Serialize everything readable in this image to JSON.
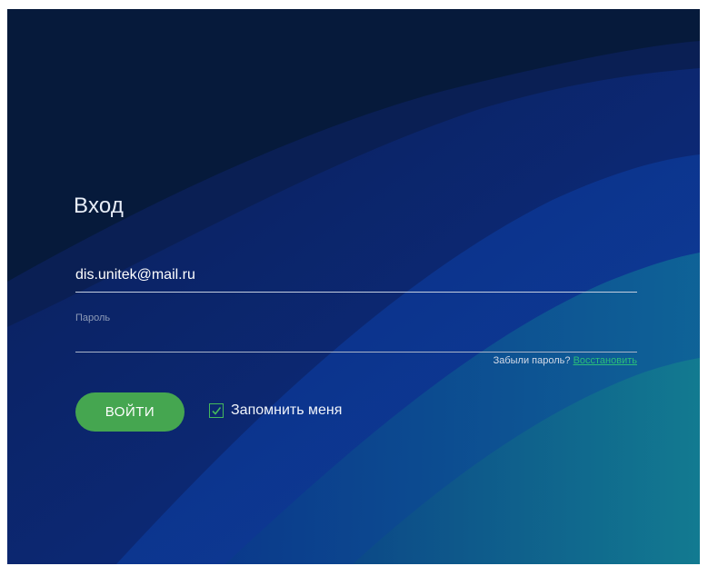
{
  "login": {
    "title": "Вход",
    "email_value": "dis.unitek@mail.ru",
    "password_placeholder": "Пароль",
    "forgot_text": "Забыли пароль?",
    "restore_link": "Восстановить",
    "submit_label": "ВОЙТИ",
    "remember_label": "Запомнить меня",
    "remember_checked": true
  },
  "colors": {
    "accent_green": "#45a650",
    "link_green": "#2bbf7a",
    "background_dark": "#05152e",
    "background_blue": "#0c2f7a",
    "wave_teal": "#0e5a8a"
  }
}
